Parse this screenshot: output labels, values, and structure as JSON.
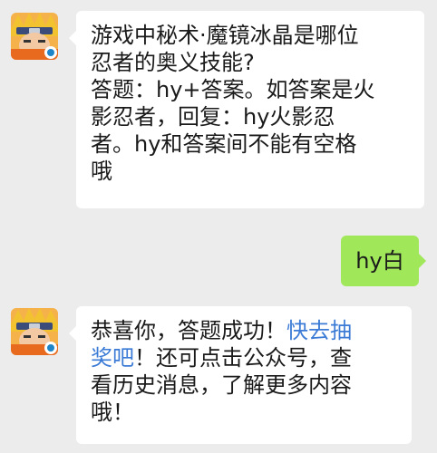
{
  "messages": [
    {
      "from": "bot",
      "avatar_icon": "naruto-avatar-icon",
      "lines": [
        "游戏中秘术·魔镜冰晶是哪位",
        "忍者的奥义技能?",
        "答题：hy+答案。如答案是火",
        "影忍者，回复：hy火影忍",
        "者。hy和答案间不能有空格",
        "哦"
      ]
    },
    {
      "from": "user",
      "text": "hy白"
    },
    {
      "from": "bot",
      "avatar_icon": "naruto-avatar-icon",
      "line1_pre": "恭喜你，答题成功！",
      "line1_link": "快去抽",
      "line2_link": "奖吧",
      "line2_post": "！还可点击公众号，查",
      "line3": "看历史消息，了解更多内容",
      "line4": "哦！"
    }
  ],
  "colors": {
    "background": "#ececec",
    "bot_bubble": "#ffffff",
    "user_bubble": "#a0e75a",
    "link": "#3b7bd6"
  }
}
